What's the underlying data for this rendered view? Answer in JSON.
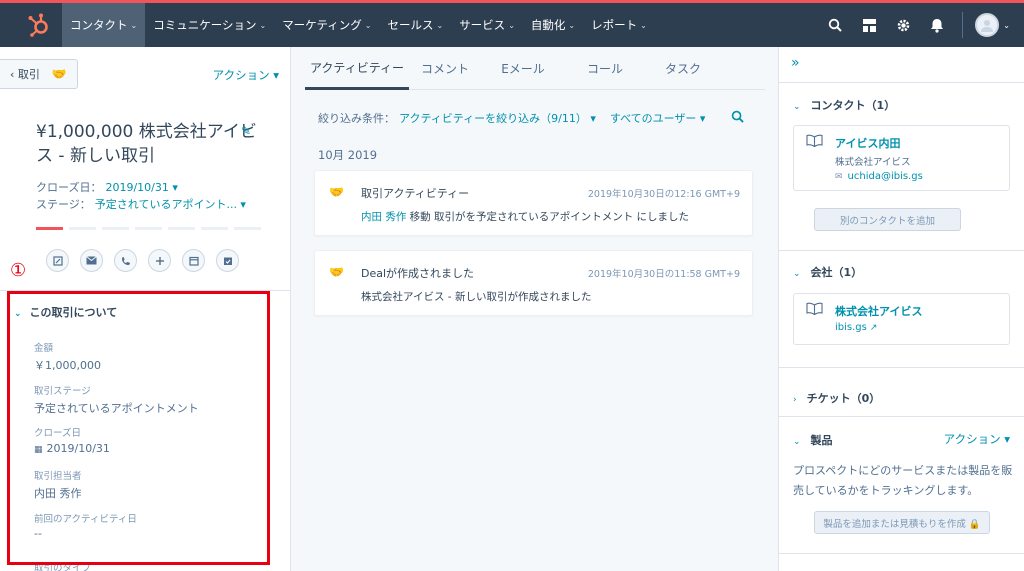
{
  "nav": {
    "items": [
      {
        "label": "コンタクト",
        "active": true
      },
      {
        "label": "コミュニケーション",
        "active": false
      },
      {
        "label": "マーケティング",
        "active": false
      },
      {
        "label": "セールス",
        "active": false
      },
      {
        "label": "サービス",
        "active": false
      },
      {
        "label": "自動化",
        "active": false
      },
      {
        "label": "レポート",
        "active": false
      }
    ],
    "icons": [
      "search-icon",
      "marketplace-icon",
      "settings-icon",
      "notifications-icon"
    ],
    "chevron": "⌄"
  },
  "left": {
    "back_label": "‹ 取引",
    "action_label": "アクション ▾",
    "title": "¥1,000,000 株式会社アイビス - 新しい取引",
    "close_date_label": "クローズ日：",
    "close_date_value": "2019/10/31 ▾",
    "stage_label": "ステージ：",
    "stage_value": "予定されているアポイント... ▾",
    "progress": {
      "filled": 1,
      "total": 7
    },
    "activity_icons": [
      "note-icon",
      "email-icon",
      "call-icon",
      "add-icon",
      "calendar-icon",
      "task-icon"
    ],
    "annotation": "①",
    "about": {
      "title": "この取引について",
      "props": [
        {
          "label": "金額",
          "value": "￥1,000,000"
        },
        {
          "label": "取引ステージ",
          "value": "予定されているアポイントメント"
        },
        {
          "label": "クローズ日",
          "value": "2019/10/31"
        },
        {
          "label": "取引担当者",
          "value": "内田 秀作"
        },
        {
          "label": "前回のアクティビティ日",
          "value": "--"
        },
        {
          "label": "取引のタイプ",
          "value": ""
        }
      ]
    }
  },
  "center": {
    "tabs": [
      {
        "label": "アクティビティー",
        "active": true
      },
      {
        "label": "コメント",
        "active": false
      },
      {
        "label": "Eメール",
        "active": false
      },
      {
        "label": "コール",
        "active": false
      },
      {
        "label": "タスク",
        "active": false
      }
    ],
    "filter_label": "絞り込み条件：",
    "filter_activity": "アクティビティーを絞り込み（9/11） ▾",
    "filter_users": "すべてのユーザー ▾",
    "month": "10月 2019",
    "cards": [
      {
        "title": "取引アクティビティー",
        "timestamp": "2019年10月30日の12:16 GMT+9",
        "who": "内田 秀作",
        "body": " 移動 取引がを予定されているアポイントメント にしました"
      },
      {
        "title": "Dealが作成されました",
        "timestamp": "2019年10月30日の11:58 GMT+9",
        "who": "",
        "body": "株式会社アイビス - 新しい取引が作成されました"
      }
    ]
  },
  "right": {
    "expand": "»",
    "contacts": {
      "title": "コンタクト（1）",
      "name": "アイビス内田",
      "company": "株式会社アイビス",
      "email": "uchida@ibis.gs",
      "add_button": "別のコンタクトを追加"
    },
    "company": {
      "title": "会社（1）",
      "name": "株式会社アイビス",
      "domain": "ibis.gs"
    },
    "tickets": {
      "title": "チケット（0）"
    },
    "products": {
      "title": "製品",
      "action": "アクション ▾",
      "description": "プロスペクトにどのサービスまたは製品を販売しているかをトラッキングします。",
      "button": "製品を追加または見積もりを作成 🔒"
    }
  }
}
